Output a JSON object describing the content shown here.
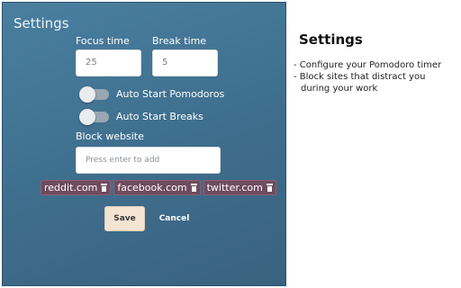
{
  "panel": {
    "title": "Settings",
    "focus_label": "Focus time",
    "focus_value": "25",
    "break_label": "Break time",
    "break_value": "5",
    "toggles": [
      {
        "label": "Auto Start Pomodoros",
        "on": false
      },
      {
        "label": "Auto Start Breaks",
        "on": false
      }
    ],
    "block_label": "Block website",
    "block_placeholder": "Press enter to add",
    "blocked_sites": [
      "reddit.com",
      "facebook.com",
      "twitter.com"
    ],
    "save_label": "Save",
    "cancel_label": "Cancel"
  },
  "description": {
    "title": "Settings",
    "items": [
      "- Configure your Pomodoro timer",
      "- Block sites that distract you during your work"
    ]
  },
  "colors": {
    "panel_bg": "#437493",
    "chip_bg": "#6f4b5e",
    "save_bg": "#f4e4d2"
  }
}
